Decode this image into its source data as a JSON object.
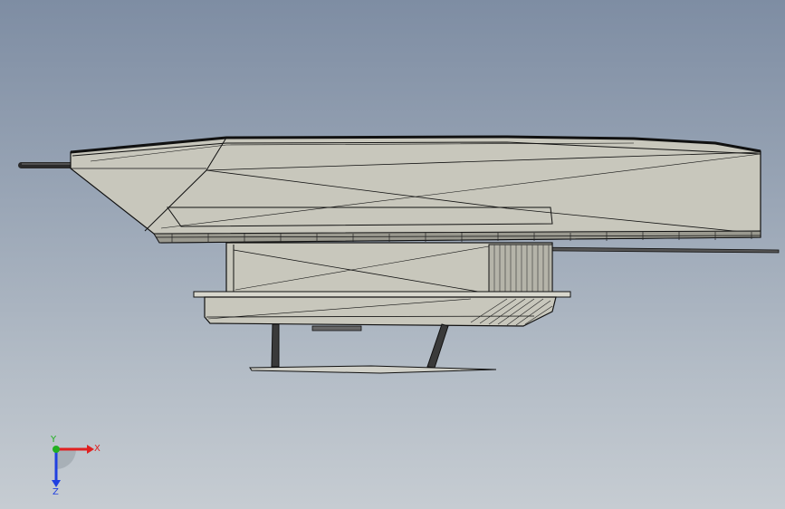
{
  "viewport": {
    "background_top": "#7e8da3",
    "background_bottom": "#c6ccd2"
  },
  "model": {
    "body_fill": "#c8c7bc",
    "edge_color": "#111111"
  },
  "triad": {
    "x_label": "X",
    "y_label": "Y",
    "z_label": "Z",
    "x_color": "#e02020",
    "y_color": "#20b020",
    "z_color": "#2040e0"
  }
}
